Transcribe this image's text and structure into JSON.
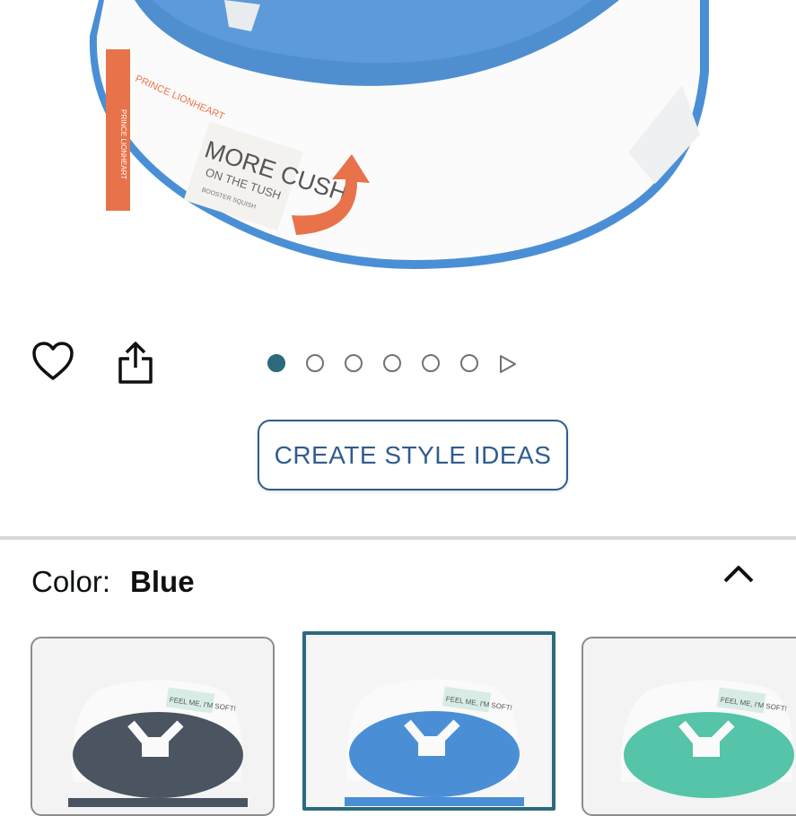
{
  "product_image": {
    "brand_text": "PRINCE LIONHEART",
    "tagline_main": "MORE CUSH",
    "tagline_sub": "ON THE TUSH",
    "product_name": "BOOSTER SQUISH",
    "colors": {
      "seat_blue": "#4a8fd6",
      "rim_blue": "#4a8fd6",
      "label_orange": "#e8734a",
      "body_white": "#fbfbfb"
    }
  },
  "actions": {
    "wishlist_icon": "heart-icon",
    "share_icon": "share-icon"
  },
  "carousel": {
    "total_dots": 6,
    "active_index": 0
  },
  "create_style_button": {
    "label": "CREATE STYLE IDEAS"
  },
  "color_selector": {
    "label": "Color:",
    "value": "Blue",
    "expanded": true,
    "swatches": [
      {
        "name": "Gray",
        "seat_color": "#4a5561",
        "badge_text": "FEEL ME, I'M SOFT!"
      },
      {
        "name": "Blue",
        "seat_color": "#4a8fd6",
        "badge_text": "FEEL ME, I'M SOFT!",
        "selected": true
      },
      {
        "name": "Teal",
        "seat_color": "#55c4a8",
        "badge_text": "FEEL ME, I'M SOFT!"
      }
    ]
  },
  "theme": {
    "accent": "#2c6a7d",
    "button_text": "#2f5d8f",
    "divider": "#d5d9d9"
  }
}
